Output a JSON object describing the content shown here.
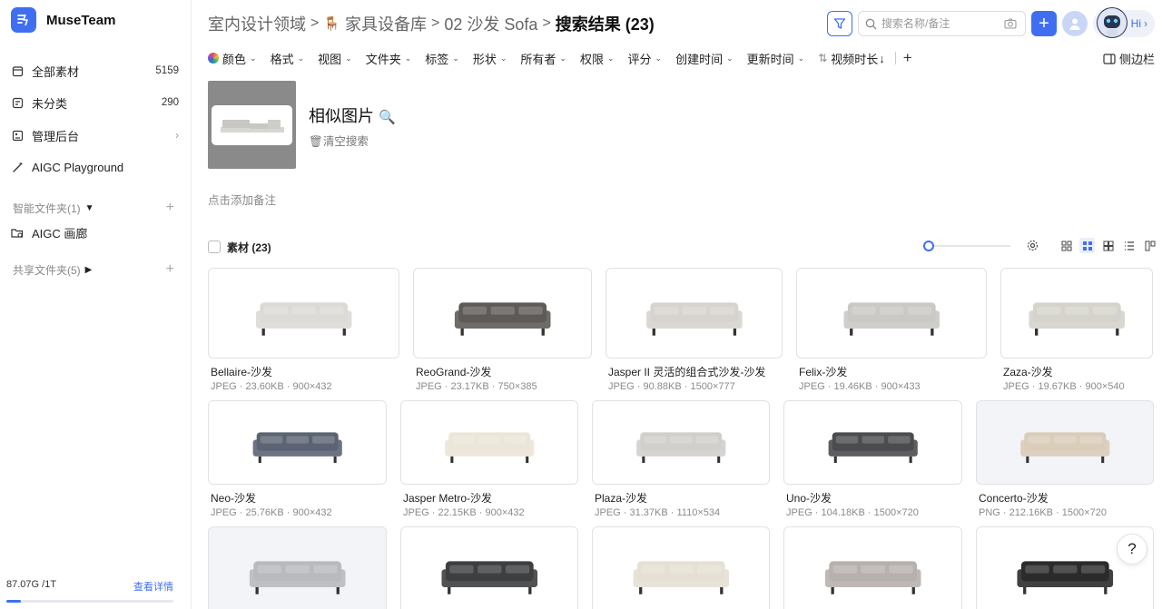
{
  "app": {
    "name": "MuseTeam",
    "accent": "#3f6ff0"
  },
  "sidebar": {
    "items": [
      {
        "label": "全部素材",
        "count": "5159",
        "icon": "folder-icon"
      },
      {
        "label": "未分类",
        "count": "290",
        "icon": "unsorted-icon"
      },
      {
        "label": "管理后台",
        "icon": "admin-icon"
      },
      {
        "label": "AIGC Playground",
        "icon": "magic-wand-icon"
      }
    ],
    "smart_folders": {
      "label": "智能文件夹(1)"
    },
    "smart_folder_items": [
      {
        "label": "AIGC 画廊"
      }
    ],
    "shared_folders": {
      "label": "共享文件夹(5)"
    },
    "storage": {
      "used": "87.07G /1T",
      "link": "查看详情",
      "fraction": 0.087
    }
  },
  "header": {
    "breadcrumb": [
      "室内设计领域",
      "家具设备库",
      "02 沙发 Sofa",
      "搜索结果 (23)"
    ],
    "search_placeholder": "搜索名称/备注",
    "hi": "Hi"
  },
  "filters": [
    "颜色",
    "格式",
    "视图",
    "文件夹",
    "标签",
    "形状",
    "所有者",
    "权限",
    "评分",
    "创建时间",
    "更新时间"
  ],
  "sort": {
    "label": "视频时长"
  },
  "sidebar_toggle": "侧边栏",
  "similar": {
    "title": "相似图片",
    "clear": "清空搜索",
    "note": "点击添加备注"
  },
  "assets": {
    "label": "素材 (23)",
    "slider_value": 0.0
  },
  "cards": [
    {
      "name": "Bellaire-沙发",
      "meta": "JPEG · 23.60KB · 900×432",
      "color": "#dcdad6"
    },
    {
      "name": "ReoGrand-沙发",
      "meta": "JPEG · 23.17KB · 750×385",
      "color": "#5e5b58"
    },
    {
      "name": "Jasper II 灵活的组合式沙发-沙发",
      "meta": "JPEG · 90.88KB · 1500×777",
      "color": "#d7d4cf"
    },
    {
      "name": "Felix-沙发",
      "meta": "JPEG · 19.46KB · 900×433",
      "color": "#cbc9c5"
    },
    {
      "name": "Zaza-沙发",
      "meta": "JPEG · 19.67KB · 900×540",
      "color": "#d5d3cc"
    },
    {
      "name": "Neo-沙发",
      "meta": "JPEG · 25.76KB · 900×432",
      "color": "#5c6473"
    },
    {
      "name": "Jasper Metro-沙发",
      "meta": "JPEG · 22.15KB · 900×432",
      "color": "#ece6d8"
    },
    {
      "name": "Plaza-沙发",
      "meta": "JPEG · 31.37KB · 1110×534",
      "color": "#d0cfcc"
    },
    {
      "name": "Uno-沙发",
      "meta": "JPEG · 104.18KB · 1500×720",
      "color": "#4b4d4f"
    },
    {
      "name": "Concerto-沙发",
      "meta": "PNG · 212.16KB · 1500×720",
      "color": "#d9cdb9"
    },
    {
      "name": "",
      "meta": "",
      "color": "#b9babc"
    },
    {
      "name": "",
      "meta": "",
      "color": "#3e3f40"
    },
    {
      "name": "",
      "meta": "",
      "color": "#e6e0d4"
    },
    {
      "name": "",
      "meta": "",
      "color": "#b7b1ae"
    },
    {
      "name": "",
      "meta": "",
      "color": "#2b2b2b"
    }
  ],
  "help": "?"
}
